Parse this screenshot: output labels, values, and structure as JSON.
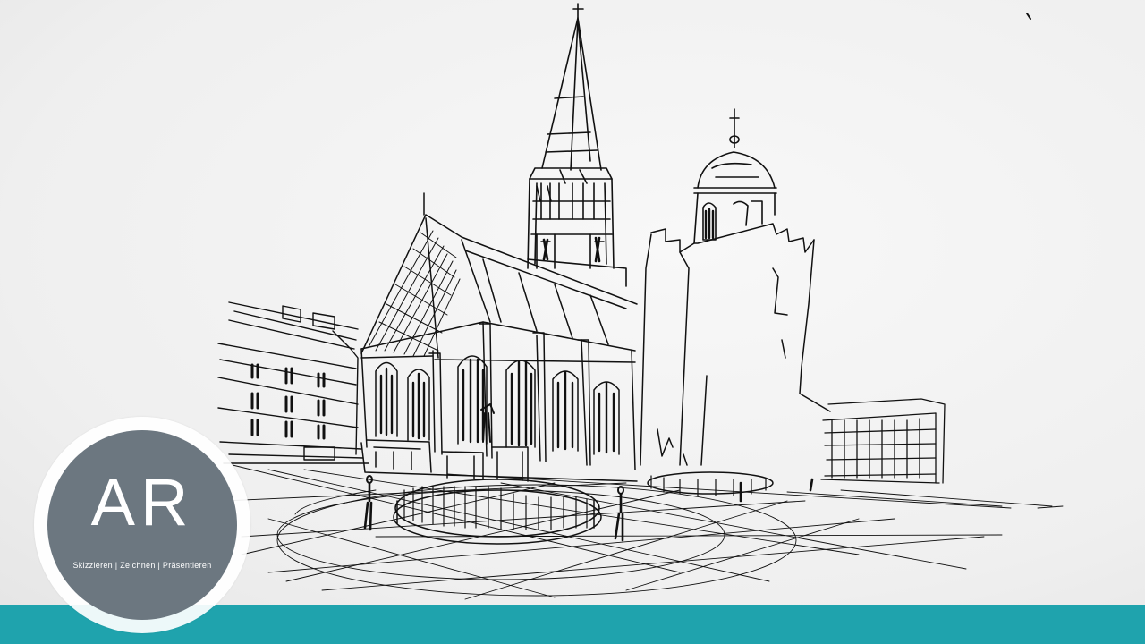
{
  "logo": {
    "initials": "AR",
    "tagline": "Skizzieren | Zeichnen | Präsentieren"
  },
  "colors": {
    "bar": "#1fa3ad",
    "disc": "#6c7780",
    "ink": "#111111",
    "paper": "#f4f4f4"
  }
}
